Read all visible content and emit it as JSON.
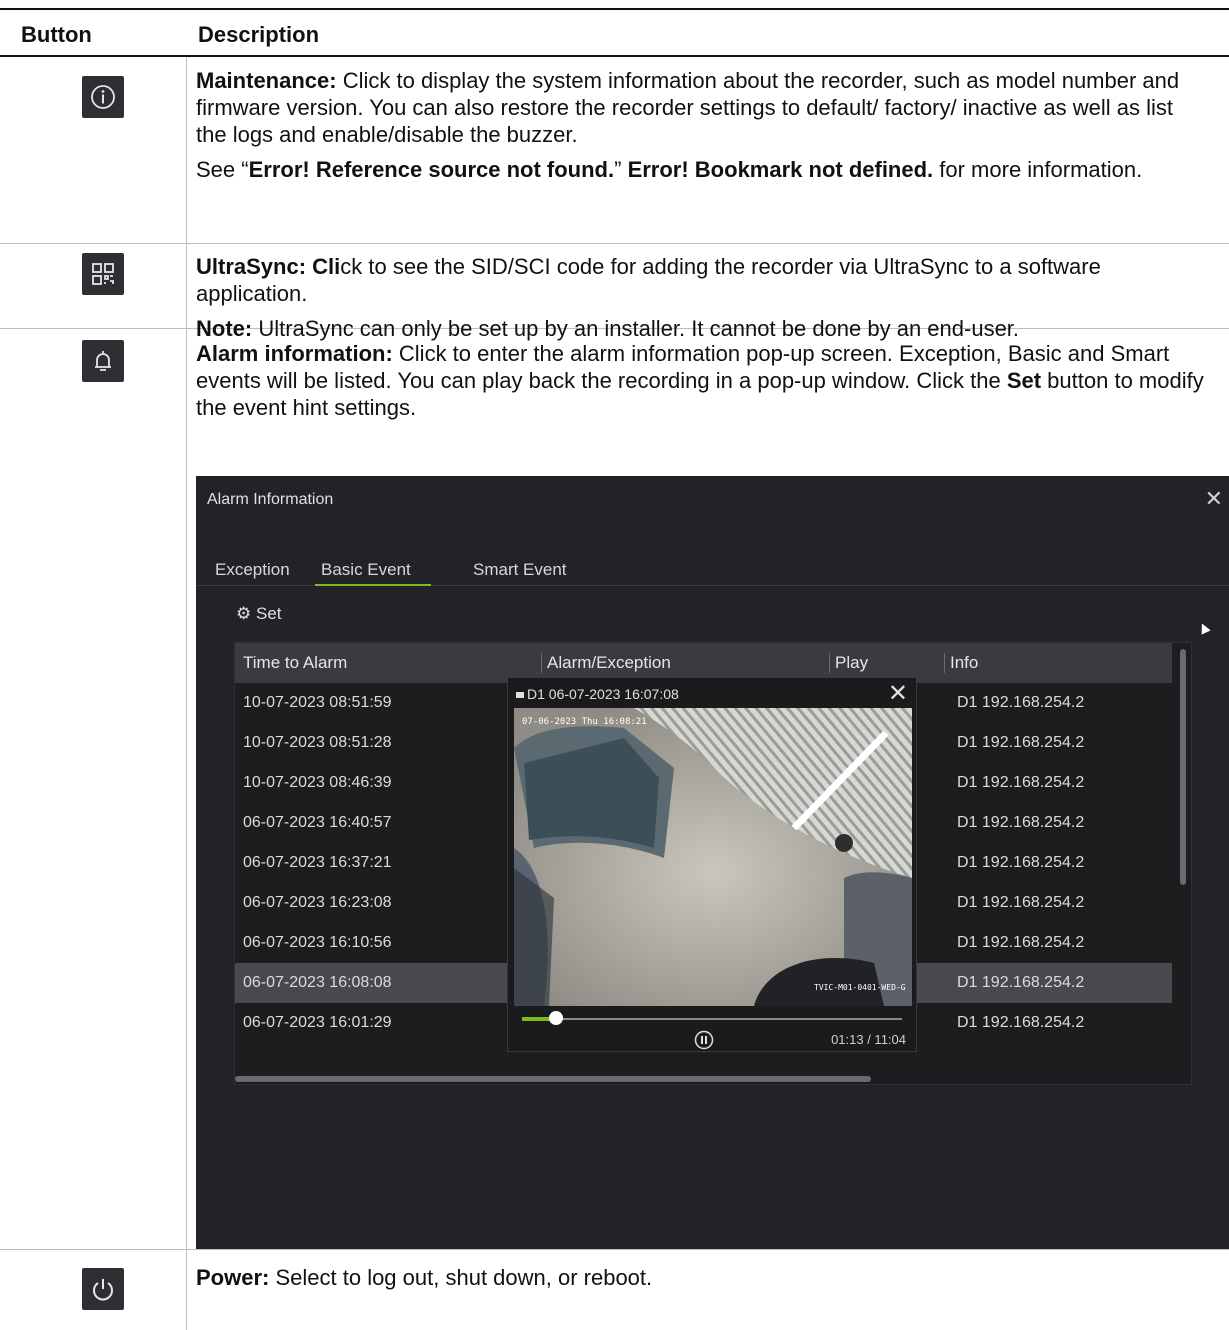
{
  "header": {
    "col_button": "Button",
    "col_description": "Description"
  },
  "rows": [
    {
      "icon": "info-icon",
      "p1_bold": "Maintenance:",
      "p1_text": " Click to display the system information about the recorder, such as model number and firmware version. You can also restore the recorder settings to default/ factory/ inactive as well as list the logs and enable/disable the buzzer.",
      "p2_pre": "See “",
      "p2_b1": "Error! Reference source not found.",
      "p2_mid": "” ",
      "p2_b2": "Error! Bookmark not defined.",
      "p2_post": " for more information."
    },
    {
      "icon": "qr-code-icon",
      "p1_bold": "UltraSync: Cli",
      "p1_text": "ck to see the SID/SCI code for adding the recorder via UltraSync to a software application.",
      "p2_bold": "Note:",
      "p2_text": " UltraSync can only be set up by an installer. It cannot be done by an end-user."
    },
    {
      "icon": "bell-icon",
      "p1_bold": "Alarm information:",
      "p1_text": " Click to enter the alarm information pop-up screen. Exception, Basic and Smart events will be listed. You can play back the recording in a pop-up window. Click the ",
      "p1_bold2": "Set",
      "p1_text2": " button to modify the event hint settings."
    },
    {
      "icon": "power-icon",
      "p1_bold": "Power:",
      "p1_text": " Select to log out, shut down, or reboot."
    }
  ],
  "alarm_window": {
    "title": "Alarm Information",
    "tabs": [
      "Exception",
      "Basic Event",
      "Smart Event"
    ],
    "active_tab": "Basic Event",
    "set_label": "Set",
    "columns": [
      "Time to Alarm",
      "Alarm/Exception",
      "Play",
      "Info"
    ],
    "rows": [
      {
        "time": "10-07-2023 08:51:59",
        "info": "D1  192.168.254.2"
      },
      {
        "time": "10-07-2023 08:51:28",
        "info": "D1  192.168.254.2"
      },
      {
        "time": "10-07-2023 08:46:39",
        "info": "D1  192.168.254.2"
      },
      {
        "time": "06-07-2023 16:40:57",
        "info": "D1  192.168.254.2"
      },
      {
        "time": "06-07-2023 16:37:21",
        "info": "D1  192.168.254.2"
      },
      {
        "time": "06-07-2023 16:23:08",
        "info": "D1  192.168.254.2"
      },
      {
        "time": "06-07-2023 16:10:56",
        "info": "D1  192.168.254.2"
      },
      {
        "time": "06-07-2023 16:08:08",
        "info": "D1  192.168.254.2"
      },
      {
        "time": "06-07-2023 16:01:29",
        "info": "D1  192.168.254.2"
      }
    ],
    "selected_row": 7,
    "playback": {
      "title": "D1 06-07-2023 16:07:08",
      "osd_time": "07-06-2023 Thu 16:08:21",
      "osd_camera": "TVIC-M01-0401-WED-G",
      "time_readout": "01:13 / 11:04",
      "progress": 0.09
    },
    "colors": {
      "accent": "#7dba1e",
      "background": "#232327"
    }
  }
}
